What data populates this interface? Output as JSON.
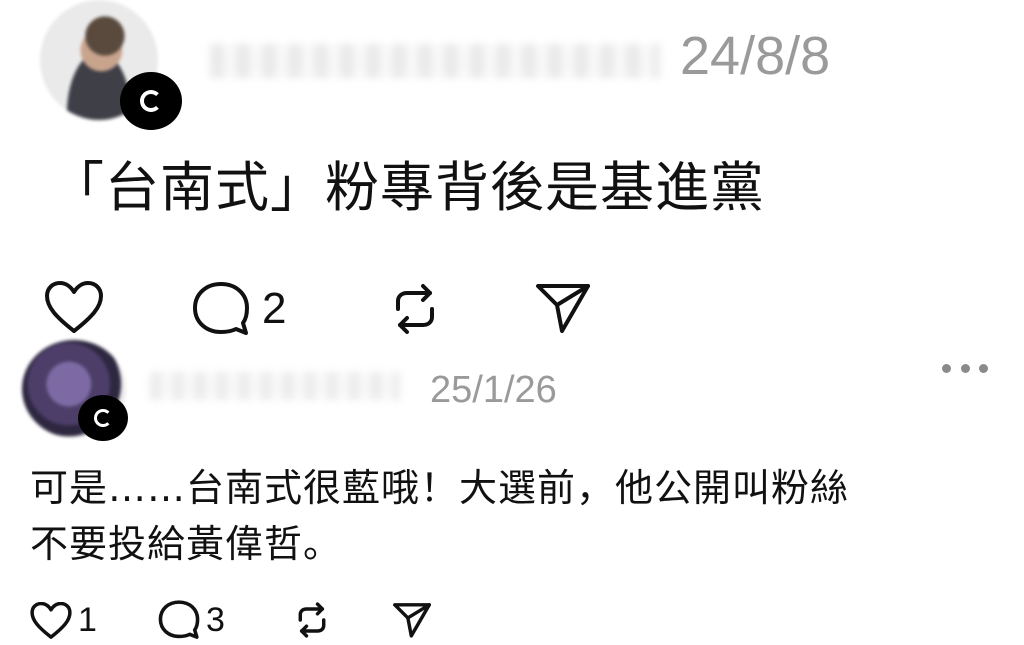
{
  "post": {
    "timestamp": "24/8/8",
    "text": "「台南式」粉專背後是基進黨",
    "actions": {
      "like_icon": "heart-icon",
      "comment_icon": "comment-icon",
      "comment_count": "2",
      "repost_icon": "repost-icon",
      "share_icon": "send-icon"
    }
  },
  "reply": {
    "timestamp": "25/1/26",
    "text_lines": [
      "可是……台南式很藍哦！大選前，他公開叫粉絲",
      "不要投給黃偉哲。"
    ],
    "more_icon": "more-horizontal-icon",
    "actions": {
      "like_icon": "heart-icon",
      "like_count": "1",
      "comment_icon": "comment-icon",
      "comment_count": "3",
      "repost_icon": "repost-icon",
      "share_icon": "send-icon"
    }
  },
  "colors": {
    "text": "#111111",
    "muted": "#9a9a9a",
    "background": "#ffffff"
  }
}
